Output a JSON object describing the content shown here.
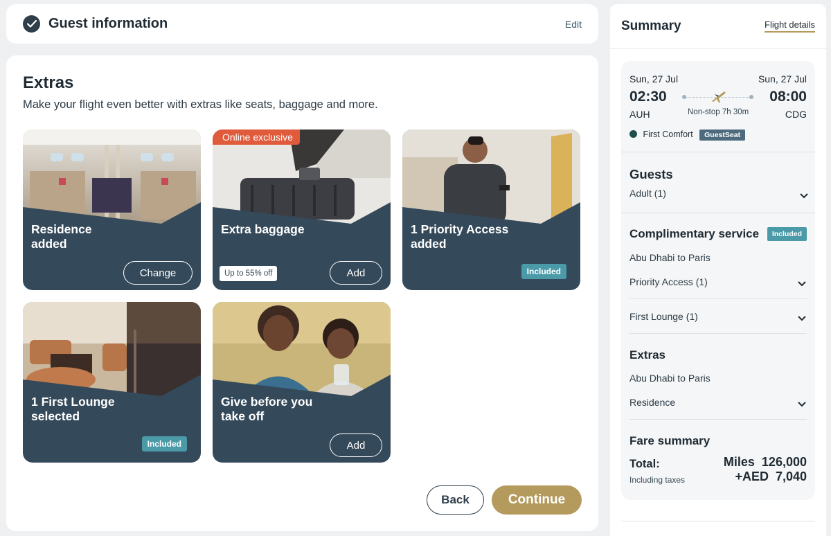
{
  "guest_section": {
    "title": "Guest information",
    "edit_label": "Edit"
  },
  "extras": {
    "title": "Extras",
    "subtitle": "Make your flight even better with extras like seats, baggage and more.",
    "cards": [
      {
        "line1": "Residence",
        "line2": "added",
        "action": "Change"
      },
      {
        "line1": "Extra baggage",
        "line2": "",
        "action": "Add",
        "exclusive": "Online exclusive",
        "discount": "Up to 55% off"
      },
      {
        "line1": "1 Priority Access",
        "line2": "added",
        "badge": "Included"
      },
      {
        "line1": "1 First Lounge",
        "line2": "selected",
        "badge": "Included"
      },
      {
        "line1": "Give before you",
        "line2": "take off",
        "action": "Add"
      }
    ],
    "back_label": "Back",
    "continue_label": "Continue"
  },
  "summary": {
    "title": "Summary",
    "tab_label": "Flight details",
    "flight": {
      "depart_date": "Sun, 27 Jul",
      "depart_time": "02:30",
      "depart_code": "AUH",
      "arrive_date": "Sun, 27 Jul",
      "arrive_time": "08:00",
      "arrive_code": "CDG",
      "duration": "Non-stop 7h 30m",
      "cabin": "First Comfort",
      "seat_badge": "GuestSeat"
    },
    "guests": {
      "title": "Guests",
      "value": "Adult (1)"
    },
    "complimentary": {
      "title": "Complimentary service",
      "badge": "Included",
      "route": "Abu Dhabi to Paris",
      "items": [
        "Priority Access (1)",
        "First Lounge (1)"
      ]
    },
    "extras": {
      "title": "Extras",
      "route": "Abu Dhabi to Paris",
      "item": "Residence"
    },
    "fare": {
      "title": "Fare summary",
      "total_label": "Total:",
      "total_sub": "Including taxes",
      "miles": "Miles  126,000",
      "aed": "+AED  7,040"
    }
  },
  "colors": {
    "accent_gold": "#b49a5c",
    "card_navy": "#34495a",
    "included_teal": "#4a9aa8",
    "exclusive_orange": "#e05a3c"
  }
}
